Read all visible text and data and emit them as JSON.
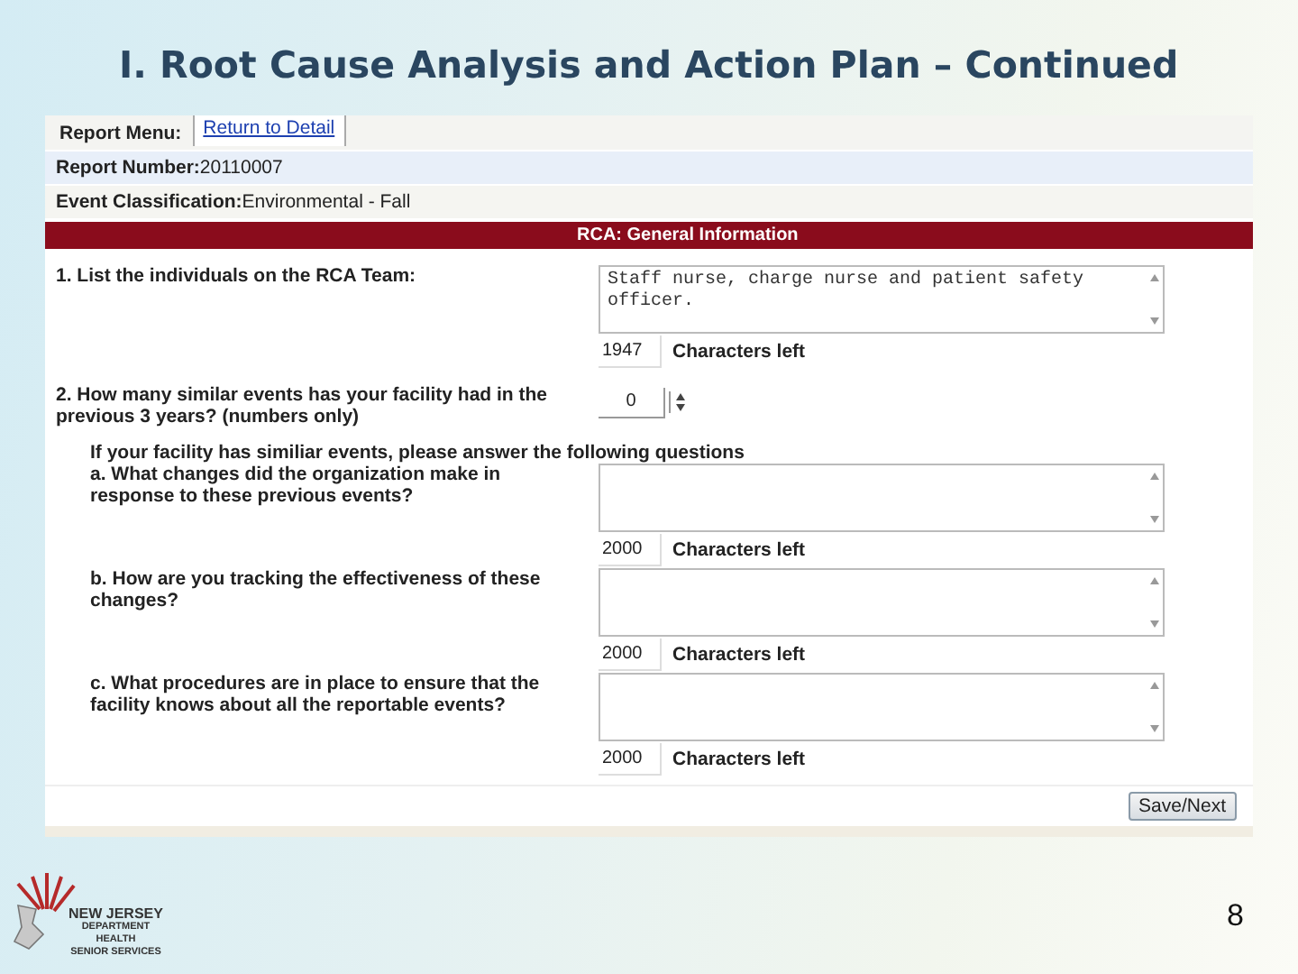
{
  "slide": {
    "title": "I.  Root Cause Analysis and Action Plan – Continued",
    "page_number": "8"
  },
  "logo": {
    "lines": [
      "NEW JERSEY",
      "DEPARTMENT",
      "HEALTH",
      "SENIOR SERVICES"
    ]
  },
  "report_menu": {
    "label": "Report Menu:",
    "link": "Return to Detail"
  },
  "info": [
    {
      "label": "Report Number:",
      "value": "20110007"
    },
    {
      "label": "Event Classification:",
      "value": "Environmental - Fall"
    }
  ],
  "section_header": "RCA: General Information",
  "questions": [
    {
      "kind": "textarea",
      "label": "1. List the individuals on the RCA Team:",
      "value": "Staff nurse, charge nurse and patient safety officer.",
      "counter": "1947",
      "counter_label": "Characters left"
    },
    {
      "kind": "number",
      "label": "2. How many similar events has your facility had in the previous 3 years? (numbers only)",
      "value": "0"
    },
    {
      "kind": "note",
      "label": "If your facility has similiar events, please answer the following questions"
    },
    {
      "kind": "subtextarea",
      "label": "a. What changes did the organization make in response to these previous events?",
      "counter": "2000",
      "counter_label": "Characters left"
    },
    {
      "kind": "subtextarea",
      "label": "b. How are you tracking the effectiveness of these changes?",
      "counter": "2000",
      "counter_label": "Characters left"
    },
    {
      "kind": "subtextarea",
      "label": "c. What procedures are in place to ensure that the facility knows about all the reportable events?",
      "counter": "2000",
      "counter_label": "Characters left"
    }
  ],
  "save_button": "Save/Next"
}
